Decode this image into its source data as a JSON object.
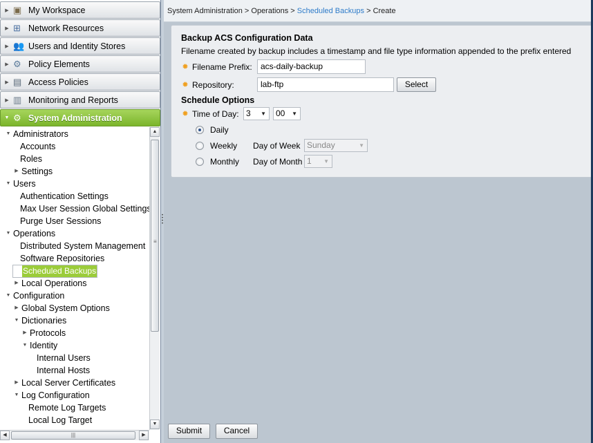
{
  "nav": {
    "drawers": [
      {
        "label": "My Workspace",
        "icon": "workspace-icon"
      },
      {
        "label": "Network Resources",
        "icon": "network-icon"
      },
      {
        "label": "Users and Identity Stores",
        "icon": "users-icon"
      },
      {
        "label": "Policy Elements",
        "icon": "policy-elements-icon"
      },
      {
        "label": "Access Policies",
        "icon": "access-policies-icon"
      },
      {
        "label": "Monitoring and Reports",
        "icon": "monitoring-icon"
      },
      {
        "label": "System Administration",
        "icon": "system-admin-icon"
      }
    ],
    "tree": [
      {
        "label": "Administrators",
        "level": 0,
        "toggle": "open"
      },
      {
        "label": "Accounts",
        "level": 1,
        "toggle": "none"
      },
      {
        "label": "Roles",
        "level": 1,
        "toggle": "none"
      },
      {
        "label": "Settings",
        "level": 1,
        "toggle": "closed"
      },
      {
        "label": "Users",
        "level": 0,
        "toggle": "open"
      },
      {
        "label": "Authentication Settings",
        "level": 1,
        "toggle": "none"
      },
      {
        "label": "Max User Session Global Settings",
        "level": 1,
        "toggle": "none"
      },
      {
        "label": "Purge User Sessions",
        "level": 1,
        "toggle": "none"
      },
      {
        "label": "Operations",
        "level": 0,
        "toggle": "open"
      },
      {
        "label": "Distributed System Management",
        "level": 1,
        "toggle": "none"
      },
      {
        "label": "Software Repositories",
        "level": 1,
        "toggle": "none"
      },
      {
        "label": "Scheduled Backups",
        "level": 1,
        "toggle": "none",
        "selected": true
      },
      {
        "label": "Local Operations",
        "level": 1,
        "toggle": "closed"
      },
      {
        "label": "Configuration",
        "level": 0,
        "toggle": "open"
      },
      {
        "label": "Global System Options",
        "level": 1,
        "toggle": "closed"
      },
      {
        "label": "Dictionaries",
        "level": 1,
        "toggle": "open"
      },
      {
        "label": "Protocols",
        "level": 2,
        "toggle": "closed"
      },
      {
        "label": "Identity",
        "level": 2,
        "toggle": "open"
      },
      {
        "label": "Internal Users",
        "level": 3,
        "toggle": "none"
      },
      {
        "label": "Internal Hosts",
        "level": 3,
        "toggle": "none"
      },
      {
        "label": "Local Server Certificates",
        "level": 1,
        "toggle": "closed"
      },
      {
        "label": "Log Configuration",
        "level": 1,
        "toggle": "open"
      },
      {
        "label": "Remote Log Targets",
        "level": 2,
        "toggle": "none"
      },
      {
        "label": "Local Log Target",
        "level": 2,
        "toggle": "none"
      }
    ]
  },
  "breadcrumb": {
    "part1": "System Administration",
    "part2": "Operations",
    "part3": "Scheduled Backups",
    "part4": "Create",
    "sep": ">"
  },
  "form": {
    "title": "Backup ACS Configuration Data",
    "description": "Filename created by backup includes a timestamp and file type information appended to the prefix entered",
    "filename_prefix_label": "Filename Prefix:",
    "filename_prefix_value": "acs-daily-backup",
    "repository_label": "Repository:",
    "repository_value": "lab-ftp",
    "select_button": "Select",
    "schedule_title": "Schedule Options",
    "time_of_day_label": "Time of Day:",
    "hour_value": "3",
    "minute_value": "00",
    "daily_label": "Daily",
    "weekly_label": "Weekly",
    "day_of_week_label": "Day of Week",
    "day_of_week_value": "Sunday",
    "monthly_label": "Monthly",
    "day_of_month_label": "Day of Month",
    "day_of_month_value": "1",
    "frequency_selected": "Daily"
  },
  "footer": {
    "submit_label": "Submit",
    "cancel_label": "Cancel"
  },
  "colors": {
    "active_drawer": "#8bc53f",
    "selected_tree_item": "#9bcc3a",
    "breadcrumb_link": "#2d7bc9",
    "required_marker": "#f0a020",
    "content_background": "#bcc6d0"
  }
}
